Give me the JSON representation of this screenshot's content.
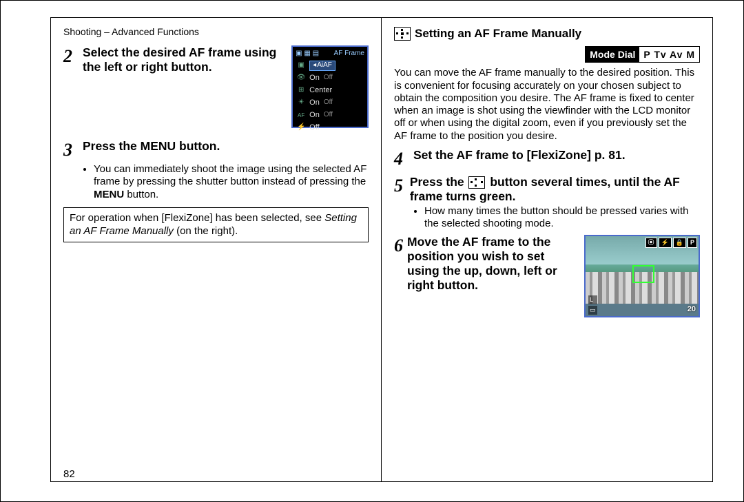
{
  "header": {
    "breadcrumb": "Shooting – Advanced Functions"
  },
  "left": {
    "step2": {
      "num": "2",
      "title": "Select the desired AF frame using the left or right button.",
      "lcd": {
        "top_right": "AF Frame",
        "selected": "AiAF",
        "rows": [
          {
            "icon": "▣",
            "v1": "AiAF",
            "v2": ""
          },
          {
            "icon": "👁",
            "v1": "On",
            "v2": "Off"
          },
          {
            "icon": "⊞",
            "v1": "Center",
            "v2": ""
          },
          {
            "icon": "☀",
            "v1": "On",
            "v2": "Off"
          },
          {
            "icon": "AF",
            "v1": "On",
            "v2": "Off"
          },
          {
            "icon": "⚡",
            "v1": "Off",
            "v2": ""
          }
        ]
      }
    },
    "step3": {
      "num": "3",
      "title": "Press the MENU button.",
      "bullet_pre": "You can immediately shoot the image using the selected AF frame by pressing the shutter button instead of pressing the ",
      "bullet_bold": "MENU",
      "bullet_post": " button."
    },
    "note": {
      "pre": "For operation when [FlexiZone] has been selected, see ",
      "ital": "Setting an AF Frame Manually",
      "post": " (on the right)."
    },
    "pagenum": "82"
  },
  "right": {
    "heading": "Setting an AF Frame Manually",
    "modedial": {
      "label": "Mode Dial",
      "values": "P Tv Av M"
    },
    "intro": "You can move the AF frame manually to the desired position. This is convenient for focusing accurately on your chosen subject to obtain the composition you desire. The AF frame is fixed to center when an image is shot using the viewfinder with the LCD monitor off or when using the digital zoom, even if you previously set the AF frame to the position you desire.",
    "step4": {
      "num": "4",
      "title": "Set the AF frame to [FlexiZone] p. 81."
    },
    "step5": {
      "num": "5",
      "title_pre": "Press the ",
      "title_post": " button several times, until the AF frame turns green.",
      "bullet": "How many times the button should be pressed varies with the selected shooting mode."
    },
    "step6": {
      "num": "6",
      "title": "Move the AF frame to the position you wish to set using the up, down, left or right button.",
      "photo": {
        "hud_icons": [
          "⦿",
          "⚡",
          "🔒",
          "P"
        ],
        "br_value": "20",
        "bl_row1": "L",
        "bl_row2": "▭"
      }
    }
  }
}
